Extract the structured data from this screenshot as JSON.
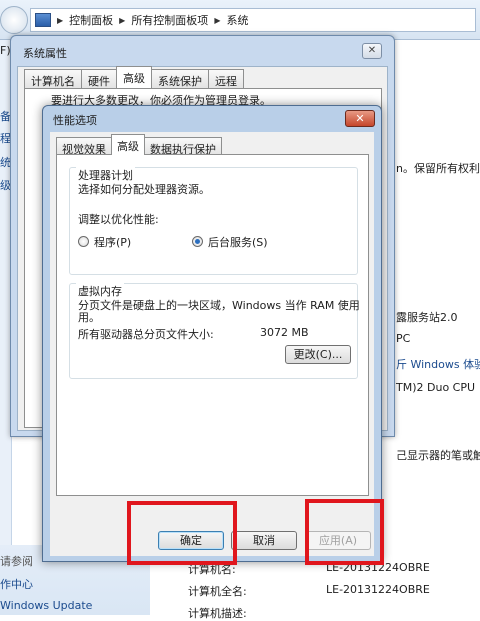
{
  "control_panel": {
    "breadcrumb": [
      "控制面板",
      "所有控制面板项",
      "系统"
    ],
    "left_fragments": [
      "F)",
      "备",
      "程",
      "统",
      "级"
    ],
    "see_also": "请参阅",
    "left_links": [
      "作中心",
      "Windows Update"
    ],
    "right_fragments": [
      "n。保留所有权利。",
      "露服务站2.0",
      "PC",
      "斤 Windows 体验",
      "TM)2 Duo CPU",
      "己显示器的笔或触控"
    ],
    "computer_info": [
      {
        "label": "计算机名:",
        "value": "LE-20131224OBRE"
      },
      {
        "label": "计算机全名:",
        "value": "LE-20131224OBRE"
      },
      {
        "label": "计算机描述:",
        "value": ""
      }
    ]
  },
  "system_properties": {
    "title": "系统属性",
    "close": "✕",
    "tabs": [
      "计算机名",
      "硬件",
      "高级",
      "系统保护",
      "远程"
    ],
    "active_tab": "高级",
    "notice": "要进行大多数更改，你必须作为管理员登录。"
  },
  "performance_options": {
    "title": "性能选项",
    "close": "✕",
    "tabs": [
      "视觉效果",
      "高级",
      "数据执行保护"
    ],
    "active_tab": "高级",
    "processor_group": {
      "title": "处理器计划",
      "description": "选择如何分配处理器资源。",
      "adjust_label": "调整以优化性能:",
      "option_programs": "程序(P)",
      "option_services": "后台服务(S)",
      "selected": "后台服务(S)"
    },
    "vm_group": {
      "title": "虚拟内存",
      "description_line1": "分页文件是硬盘上的一块区域，Windows 当作 RAM 使用",
      "description_line2": "用。",
      "total_label": "所有驱动器总分页文件大小:",
      "total_value": "3072 MB",
      "change_button": "更改(C)..."
    },
    "buttons": {
      "ok": "确定",
      "cancel": "取消",
      "apply": "应用(A)"
    }
  },
  "colors": {
    "highlight_red": "#e0161d",
    "title_bar": "#b9cfe8",
    "close_red": "#c5462b"
  }
}
